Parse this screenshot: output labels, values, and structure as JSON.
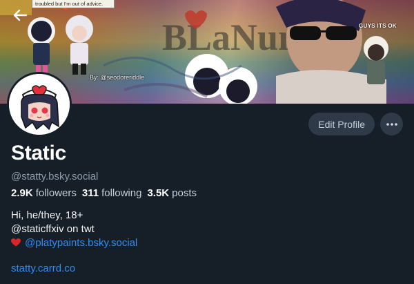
{
  "banner": {
    "advice_text": "troubled but I'm out of advice.",
    "caption": "By: @seodoreriddle",
    "tag": "GUYS ITS OK"
  },
  "profile": {
    "display_name": "Static",
    "handle": "@statty.bsky.social",
    "edit_label": "Edit Profile",
    "more_label": "•••"
  },
  "stats": {
    "followers_count": "2.9K",
    "followers_label": "followers",
    "following_count": "311",
    "following_label": "following",
    "posts_count": "3.5K",
    "posts_label": "posts"
  },
  "bio": {
    "line1": "Hi, he/they, 18+",
    "line2": "@staticffxiv on twt",
    "mention": "@platypaints.bsky.social",
    "link": "statty.carrd.co"
  },
  "colors": {
    "background": "#161e27",
    "button": "#2e3a48",
    "link": "#2f8df5",
    "heart": "#d8242b"
  },
  "icons": {
    "back": "arrow-left-icon",
    "more": "ellipsis-icon",
    "heart": "red-heart-icon"
  }
}
